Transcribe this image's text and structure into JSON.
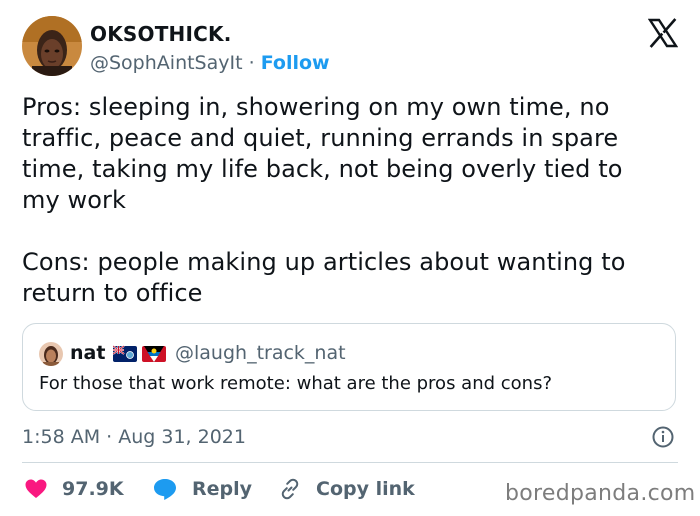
{
  "tweet": {
    "author": {
      "display_name": "OKSOTHICK.",
      "handle": "@SophAintSayIt",
      "separator": "·",
      "follow_label": "Follow",
      "avatar_icon": "profile-photo-icon"
    },
    "brand_icon": "x-logo-icon",
    "text": "Pros: sleeping in, showering on my own time, no\ntraffic, peace and quiet, running errands in spare\ntime, taking my life back, not being overly tied to\nmy work\n\nCons: people making up articles about wanting to\nreturn to office",
    "quoted_tweet": {
      "author_name": "nat",
      "flags": [
        "falkland-islands-flag-icon",
        "antigua-and-barbuda-flag-icon"
      ],
      "handle": "@laugh_track_nat",
      "text": "For those that work remote: what are the pros and cons?"
    },
    "timestamp": "1:58 AM · Aug 31, 2021",
    "info_icon": "info-icon",
    "actions": {
      "like_count": "97.9K",
      "reply_label": "Reply",
      "copy_link_label": "Copy link"
    }
  },
  "watermark": "boredpanda.com",
  "colors": {
    "accent": "#1d9bf0",
    "like_red": "#f91880",
    "text_primary": "#0f1419",
    "text_secondary": "#536471",
    "border": "#cfd9de"
  }
}
